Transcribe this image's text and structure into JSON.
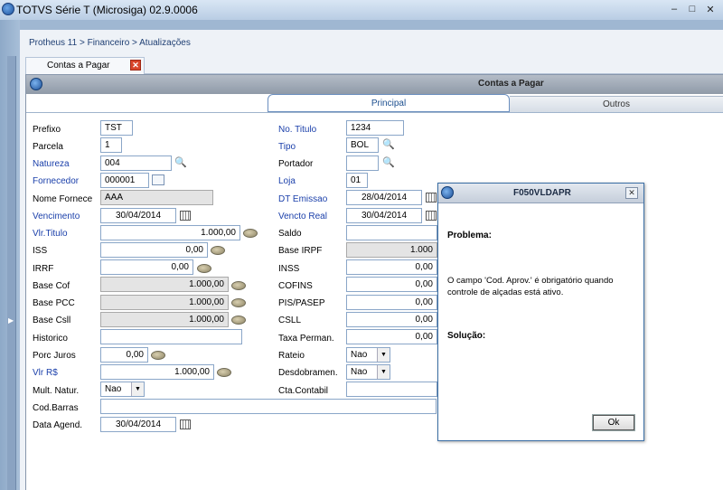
{
  "window": {
    "title": "TOTVS Série T  (Microsiga) 02.9.0006",
    "controls": [
      "minimize-icon",
      "maximize-icon",
      "close-icon"
    ]
  },
  "breadcrumb": "Protheus 11 > Financeiro > Atualizações",
  "doc_tab": {
    "label": "Contas a Pagar",
    "close": "✕"
  },
  "form": {
    "title": "Contas a Pagar",
    "tabs": {
      "principal": "Principal",
      "outros": "Outros"
    },
    "fields": {
      "prefixo": {
        "label": "Prefixo",
        "value": "TST"
      },
      "no_titulo": {
        "label": "No. Titulo",
        "value": "1234"
      },
      "parcela": {
        "label": "Parcela",
        "value": "1"
      },
      "tipo": {
        "label": "Tipo",
        "value": "BOL"
      },
      "natureza": {
        "label": "Natureza",
        "value": "004"
      },
      "portador": {
        "label": "Portador",
        "value": ""
      },
      "fornecedor": {
        "label": "Fornecedor",
        "value": "000001"
      },
      "loja": {
        "label": "Loja",
        "value": "01"
      },
      "nome_fornece": {
        "label": "Nome Fornece",
        "value": "AAA"
      },
      "dt_emissao": {
        "label": "DT Emissao",
        "value": "28/04/2014"
      },
      "vencimento": {
        "label": "Vencimento",
        "value": "30/04/2014"
      },
      "vencto_real": {
        "label": "Vencto Real",
        "value": "30/04/2014"
      },
      "vlr_titulo": {
        "label": "Vlr.Titulo",
        "value": "1.000,00"
      },
      "saldo": {
        "label": "Saldo",
        "value": ""
      },
      "iss": {
        "label": "ISS",
        "value": "0,00"
      },
      "base_irpf": {
        "label": "Base IRPF",
        "value": "1.000"
      },
      "irrf": {
        "label": "IRRF",
        "value": "0,00"
      },
      "inss": {
        "label": "INSS",
        "value": "0,00"
      },
      "base_cof": {
        "label": "Base Cof",
        "value": "1.000,00"
      },
      "cofins": {
        "label": "COFINS",
        "value": "0,00"
      },
      "base_pcc": {
        "label": "Base PCC",
        "value": "1.000,00"
      },
      "pis_pasep": {
        "label": "PIS/PASEP",
        "value": "0,00"
      },
      "base_csll": {
        "label": "Base Csll",
        "value": "1.000,00"
      },
      "csll": {
        "label": "CSLL",
        "value": "0,00"
      },
      "historico": {
        "label": "Historico",
        "value": ""
      },
      "taxa_perman": {
        "label": "Taxa Perman.",
        "value": "0,00"
      },
      "porc_juros": {
        "label": "Porc Juros",
        "value": "0,00"
      },
      "rateio": {
        "label": "Rateio",
        "value": "Nao"
      },
      "vlr_rs": {
        "label": "Vlr R$",
        "value": "1.000,00"
      },
      "desdobramen": {
        "label": "Desdobramen.",
        "value": "Nao"
      },
      "mult_natur": {
        "label": "Mult. Natur.",
        "value": "Nao"
      },
      "cta_contabil": {
        "label": "Cta.Contabil",
        "value": ""
      },
      "cod_barras": {
        "label": "Cod.Barras",
        "value": ""
      },
      "data_agend": {
        "label": "Data Agend.",
        "value": "30/04/2014"
      }
    }
  },
  "dialog": {
    "title": "F050VLDAPR",
    "problem_label": "Problema:",
    "message": "O campo 'Cod. Aprov.' é obrigatório quando controle de alçadas está ativo.",
    "solution_label": "Solução:",
    "ok_label": "Ok",
    "close": "✕"
  }
}
